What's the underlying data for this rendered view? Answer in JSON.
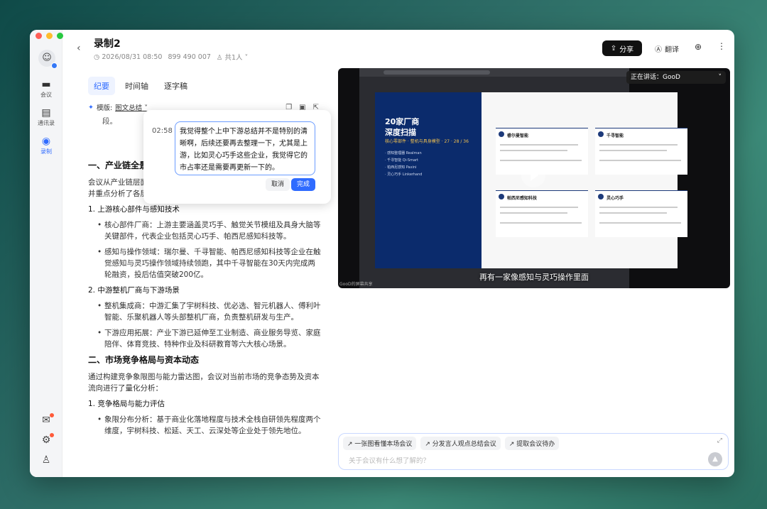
{
  "app": {
    "title": "录制2",
    "meta_date": "2026/08/31 08:50",
    "meta_size": "899 490 007",
    "meta_people": "共1人"
  },
  "rail": {
    "items": [
      {
        "label": "会议",
        "icon": "video-icon"
      },
      {
        "label": "通讯录",
        "icon": "contacts-icon"
      },
      {
        "label": "录制",
        "icon": "record-icon"
      }
    ]
  },
  "header": {
    "share_label": "分享",
    "translate_label": "翻译"
  },
  "tabs": [
    "纪要",
    "时间轴",
    "逐字稿"
  ],
  "template": {
    "label": "模版:",
    "value": "图文总结"
  },
  "popup": {
    "time": "02:58",
    "text": "我觉得整个上中下游总结并不是特别的清晰啊，后续还要再去整理一下，尤其是上游，比如灵心巧手这些企业，我觉得它的市占率还是需要再更新一下的。",
    "cancel": "取消",
    "done": "完成"
  },
  "doc": {
    "frag1": "段。",
    "h1": "一、产业链全景",
    "intro": "会议从产业链层面",
    "intro2": "并重点分析了各层级代表企业的市场份额和变化。",
    "sub1": "1. 上游核心部件与感知技术",
    "b1": "核心部件厂商：上游主要涵盖灵巧手、触觉关节模组及具身大脑等关键部件，代表企业包括灵心巧手、帕西尼感知科技等。",
    "b2": "感知与操作领域：瑞尔曼、千寻智能、帕西尼感知科技等企业在触觉感知与灵巧操作领域持续领跑，其中千寻智能在30天内完成两轮融资，投后估值突破200亿。",
    "sub2": "2. 中游整机厂商与下游场景",
    "b3": "整机集成商：中游汇集了宇树科技、优必选、智元机器人、傅利叶智能、乐聚机器人等头部整机厂商，负责整机研发与生产。",
    "b4": "下游应用拓展：产业下游已延伸至工业制造、商业服务导览、家庭陪伴、体育竞技、特种作业及科研教育等六大核心场景。",
    "h2": "二、市场竞争格局与资本动态",
    "p2": "通过构建竞争象限图与能力雷达图，会议对当前市场的竞争态势及资本流向进行了量化分析：",
    "sub3": "1. 竞争格局与能力评估",
    "b5": "象限分布分析：基于商业化落地程度与技术全栈自研领先程度两个维度，宇树科技、松延、天工、云深处等企业处于领先地位。"
  },
  "video": {
    "speaker_label": "正在讲话：GooD",
    "subtitle": "再有一家像感知与灵巧操作里面",
    "slide_title1": "20家厂商",
    "slide_title2": "深度扫描",
    "slide_sub": "核心零部件 · 整机与具身模型 · 27 · 28 / 36",
    "slide_list": [
      "· 感知整理器 Realman",
      "· 千寻智能 Qi-Smart",
      "· 帕西尼感知 Paxini",
      "· 灵心巧手 Linkerhand"
    ],
    "cards": [
      "睿尔曼智能",
      "千寻智能",
      "帕西尼感知科技",
      "灵心巧手"
    ],
    "watermark": "GooD的屏幕共享"
  },
  "chat": {
    "chips": [
      "↗ 一张图看懂本场会议",
      "↗ 分发言人观点总结会议",
      "↗ 提取会议待办"
    ],
    "placeholder": "关于会议有什么想了解的？"
  }
}
